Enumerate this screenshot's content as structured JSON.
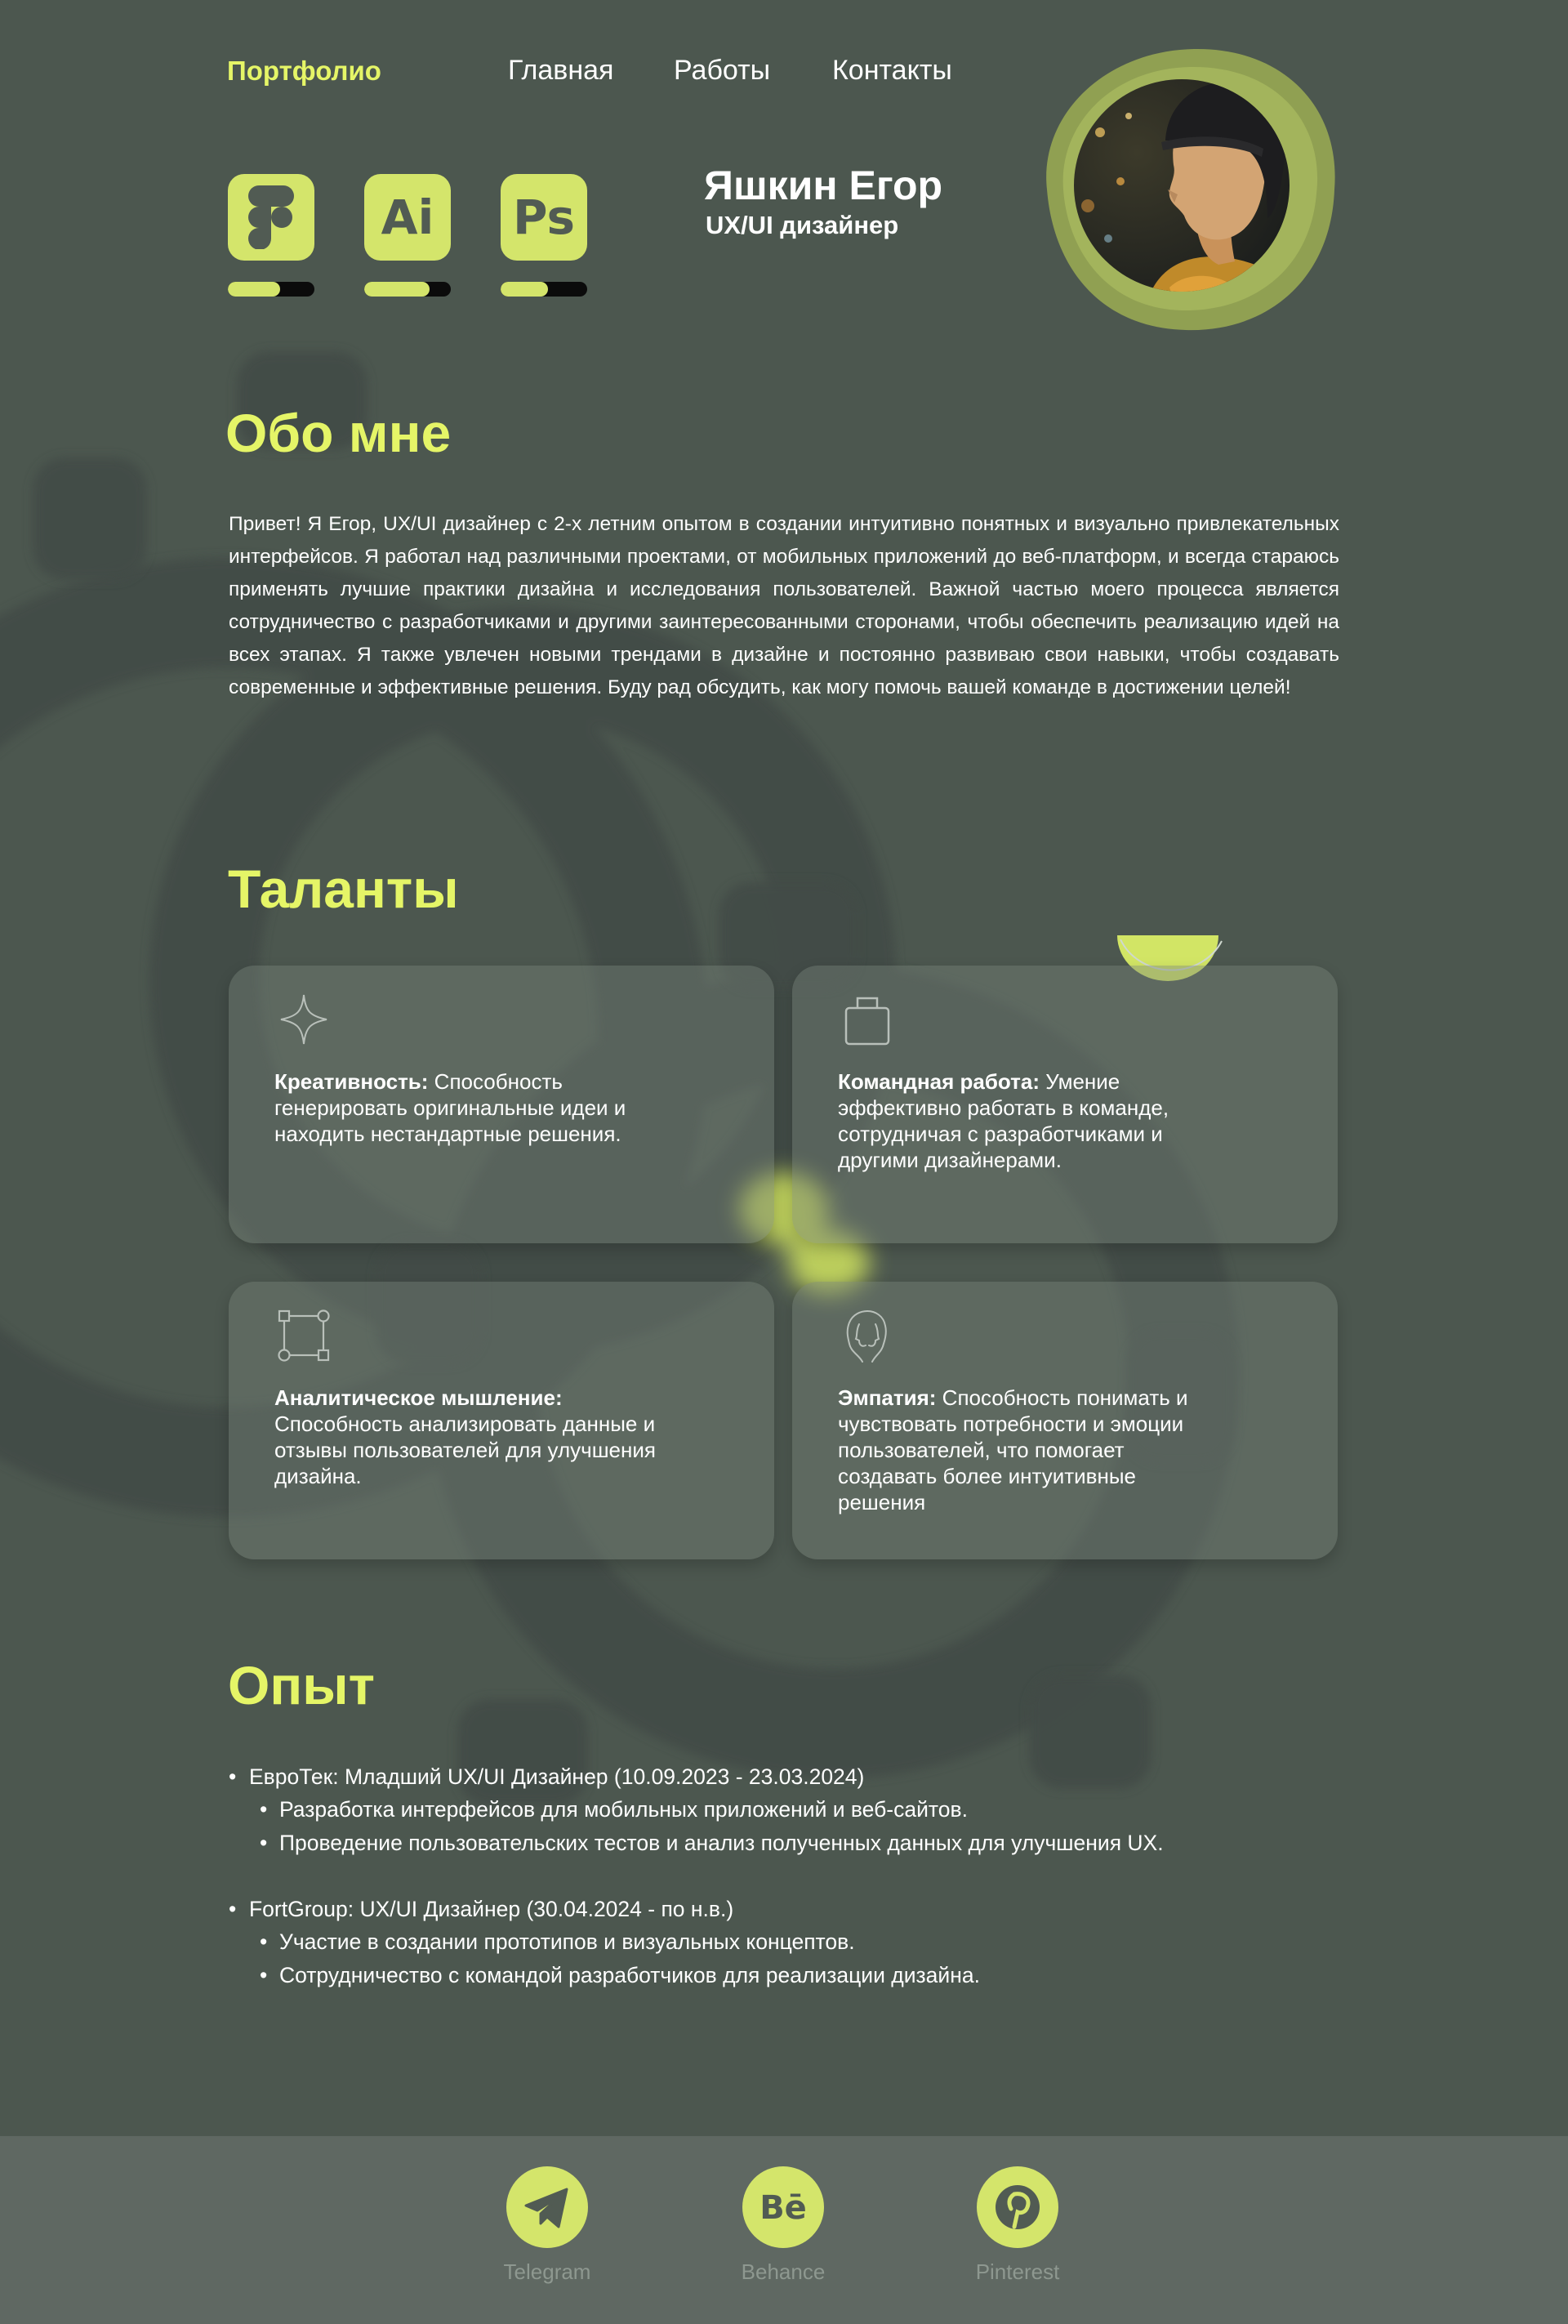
{
  "nav": {
    "logo": "Портфолио",
    "links": [
      {
        "label": "Главная"
      },
      {
        "label": "Работы"
      },
      {
        "label": "Контакты"
      }
    ]
  },
  "tools": [
    {
      "icon": "figma-icon",
      "label": "",
      "level": 0.6
    },
    {
      "icon": "illustrator-icon",
      "label": "Ai",
      "level": 0.75
    },
    {
      "icon": "photoshop-icon",
      "label": "Ps",
      "level": 0.55
    }
  ],
  "profile": {
    "name": "Яшкин Егор",
    "role": "UX/UI дизайнер"
  },
  "about": {
    "title": "Обо мне",
    "text": "Привет! Я Егор, UX/UI дизайнер с 2-х летним опытом в создании интуитивно понятных и визуально привлекательных интерфейсов. Я работал над различными проектами, от мобильных приложений до веб-платформ, и всегда стараюсь применять лучшие практики дизайна и исследования пользователей. Важной частью моего процесса является сотрудничество с разработчиками и другими заинтересованными сторонами, чтобы обеспечить реализацию идей на всех этапах. Я также увлечен новыми трендами в дизайне и постоянно развиваю свои навыки, чтобы создавать современные и эффективные решения. Буду рад обсудить, как могу помочь вашей команде в достижении целей!"
  },
  "talents": {
    "title": "Таланты",
    "items": [
      {
        "icon": "sparkle-icon",
        "title": "Креативность:",
        "text": " Способность генерировать оригинальные идеи и находить нестандартные решения."
      },
      {
        "icon": "briefcase-icon",
        "title": "Командная работа:",
        "text": " Умение эффективно работать в команде, сотрудничая с разработчиками и другими дизайнерами."
      },
      {
        "icon": "vector-frame-icon",
        "title": "Аналитическое мышление:",
        "text": " Способность анализировать данные и отзывы пользователей для улучшения дизайна."
      },
      {
        "icon": "empathy-faces-icon",
        "title": "Эмпатия:",
        "text": " Способность понимать и чувствовать потребности и эмоции пользователей, что помогает создавать более интуитивные решения"
      }
    ]
  },
  "experience": {
    "title": "Опыт",
    "jobs": [
      {
        "title": "ЕвроТек: Младший UX/UI Дизайнер (10.09.2023 - 23.03.2024)",
        "duties": [
          "Разработка интерфейсов для мобильных приложений и веб-сайтов.",
          "Проведение пользовательских тестов и анализ полученных данных для улучшения UX."
        ]
      },
      {
        "title": "FortGroup: UX/UI Дизайнер (30.04.2024 - по н.в.)",
        "duties": [
          "Участие в создании прототипов и визуальных концептов.",
          "Сотрудничество с командой разработчиков для реализации дизайна."
        ]
      }
    ]
  },
  "footer": {
    "socials": [
      {
        "label": "Telegram",
        "icon": "telegram-icon"
      },
      {
        "label": "Behance",
        "icon": "behance-icon"
      },
      {
        "label": "Pinterest",
        "icon": "pinterest-icon"
      }
    ]
  },
  "colors": {
    "background": "#4c574f",
    "accent": "#e5f567",
    "tool_green": "#d4e56b",
    "footer": "#5f6862",
    "footer_label": "#8e9890"
  }
}
